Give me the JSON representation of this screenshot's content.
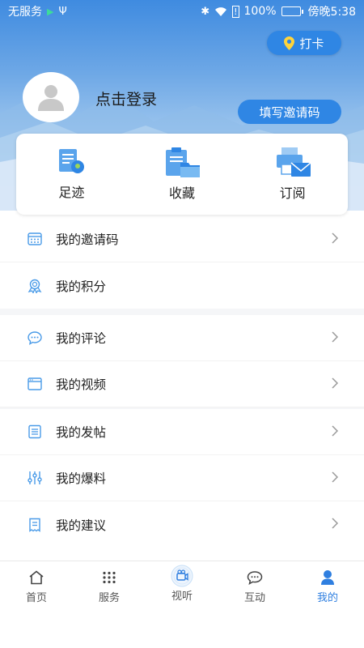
{
  "status_bar": {
    "carrier": "无服务",
    "battery_percent": "100%",
    "time": "傍晚5:38",
    "battery_level": 1.0
  },
  "header": {
    "checkin_label": "打卡",
    "login_prompt": "点击登录",
    "invite_button": "填写邀请码"
  },
  "quick_actions": [
    {
      "label": "足迹",
      "icon": "footprint-doc-icon"
    },
    {
      "label": "收藏",
      "icon": "clipboard-folder-icon"
    },
    {
      "label": "订阅",
      "icon": "printer-mail-icon"
    }
  ],
  "menu": {
    "items": [
      {
        "label": "我的邀请码",
        "icon": "calendar-grid-icon",
        "chevron": true
      },
      {
        "label": "我的积分",
        "icon": "medal-icon",
        "chevron": false
      },
      {
        "label": "我的评论",
        "icon": "chat-bubble-icon",
        "chevron": true
      },
      {
        "label": "我的视频",
        "icon": "video-window-icon",
        "chevron": true
      },
      {
        "label": "我的发帖",
        "icon": "document-list-icon",
        "chevron": true
      },
      {
        "label": "我的爆料",
        "icon": "sliders-icon",
        "chevron": true
      },
      {
        "label": "我的建议",
        "icon": "receipt-icon",
        "chevron": true
      }
    ]
  },
  "tabbar": {
    "tabs": [
      {
        "label": "首页",
        "icon": "home-icon",
        "active": false
      },
      {
        "label": "服务",
        "icon": "grid-dots-icon",
        "active": false
      },
      {
        "label": "视听",
        "icon": "camera-circle-icon",
        "active": false
      },
      {
        "label": "互动",
        "icon": "chat-dots-icon",
        "active": false
      },
      {
        "label": "我的",
        "icon": "person-icon",
        "active": true
      }
    ]
  },
  "colors": {
    "accent": "#2f86e4",
    "icon_blue": "#4a9be8",
    "tab_active": "#2f7fe0"
  }
}
